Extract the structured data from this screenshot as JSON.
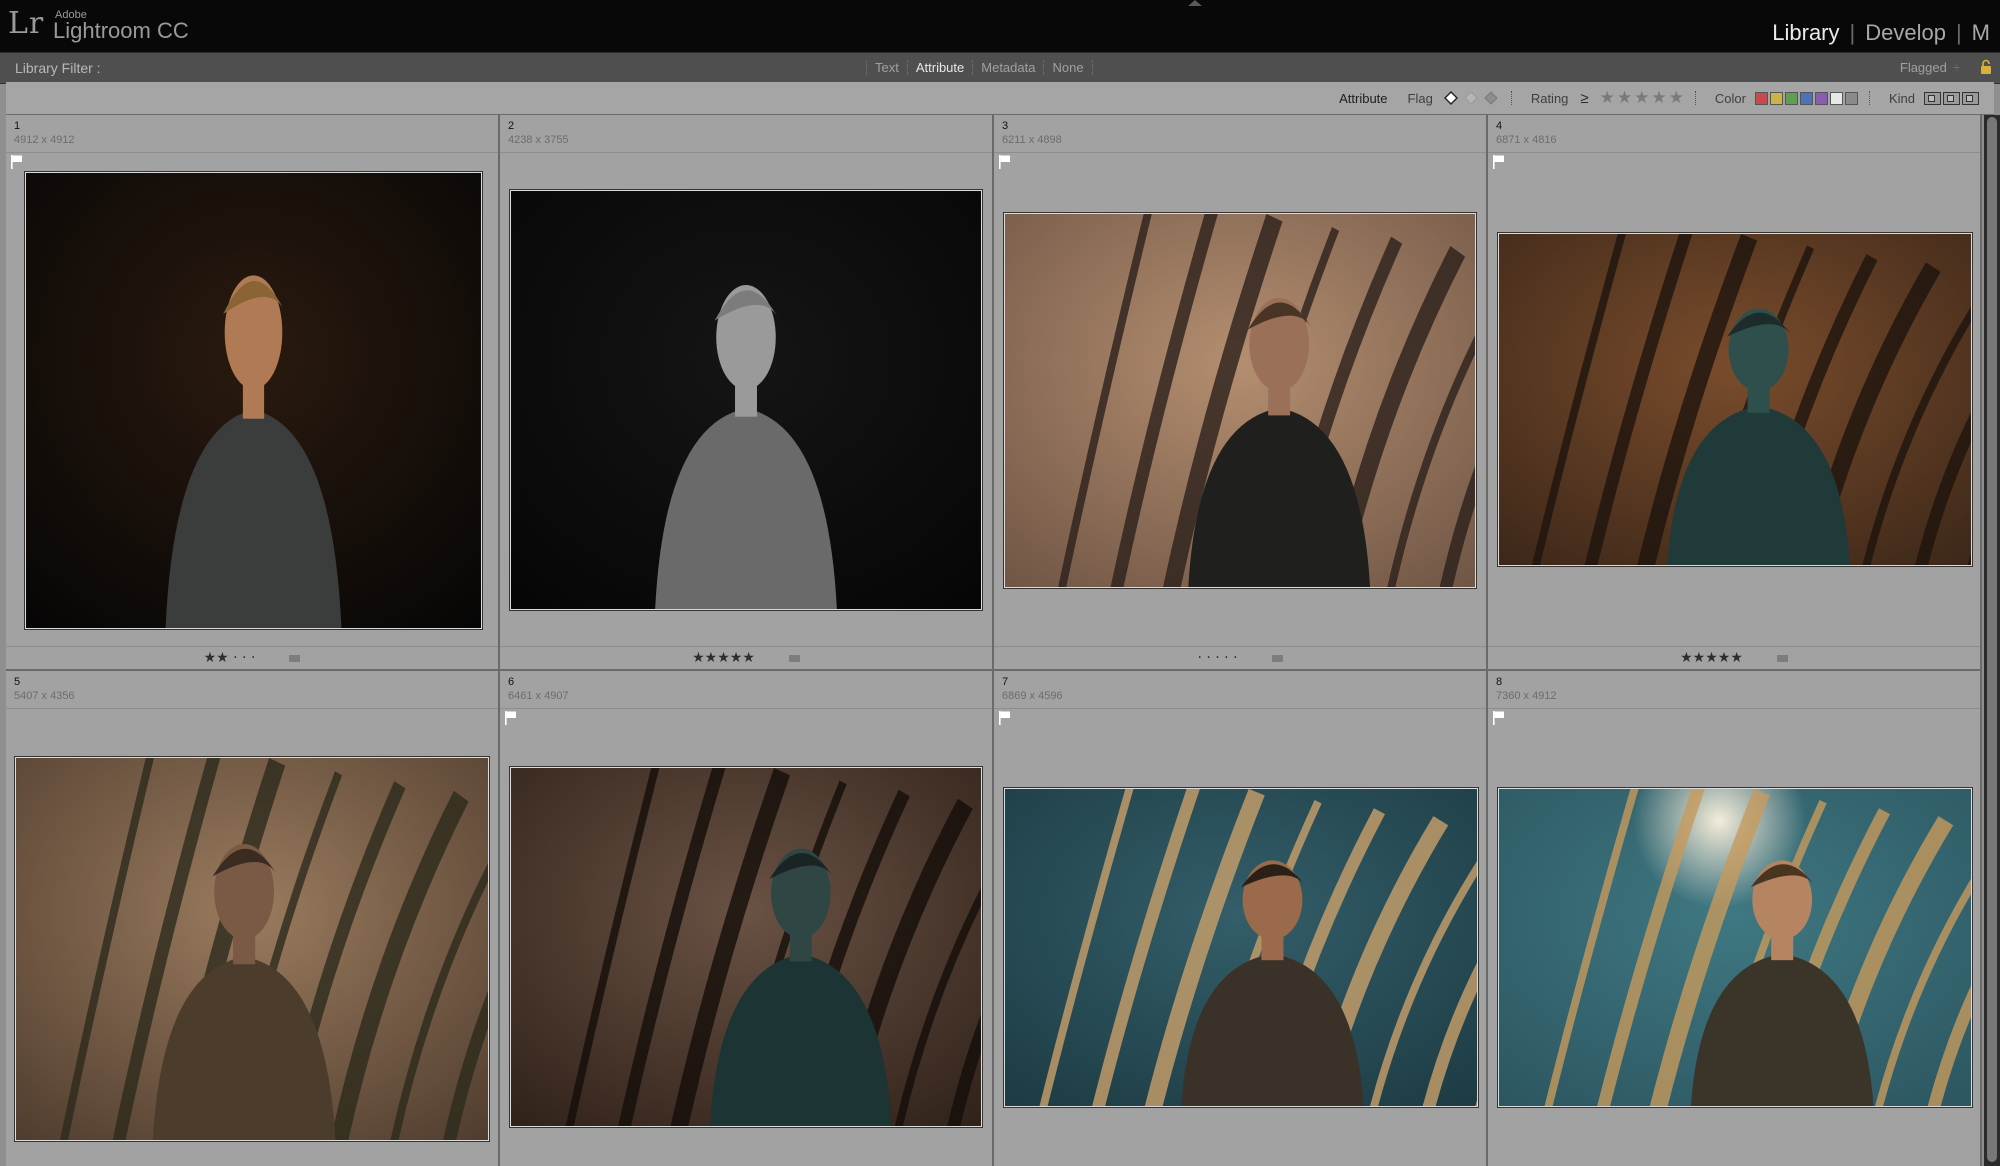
{
  "app": {
    "logo": "Lr",
    "vendor": "Adobe",
    "product": "Lightroom CC"
  },
  "modules": [
    {
      "label": "Library",
      "active": true
    },
    {
      "label": "Develop",
      "active": false
    },
    {
      "label": "M",
      "active": false
    }
  ],
  "library_filter": {
    "label": "Library Filter :",
    "modes": [
      {
        "label": "Text",
        "active": false
      },
      {
        "label": "Attribute",
        "active": true
      },
      {
        "label": "Metadata",
        "active": false
      },
      {
        "label": "None",
        "active": false
      }
    ],
    "preset": "Flagged",
    "preset_caret": "÷"
  },
  "attribute_bar": {
    "title": "Attribute",
    "flag_label": "Flag",
    "rating_label": "Rating",
    "rating_operator": "≥",
    "rating_stars": 5,
    "color_label": "Color",
    "colors": [
      "#c84a4a",
      "#c9b44a",
      "#5f9f4f",
      "#4f72b7",
      "#8a5bb0",
      "#e8e8e8",
      "#8a8a8a"
    ],
    "kind_label": "Kind"
  },
  "grid": {
    "photos": [
      {
        "index": "1",
        "dims": "4912 x 4912",
        "flagged": true,
        "rating": "★★ · · ·",
        "palette": "warm-dark"
      },
      {
        "index": "2",
        "dims": "4238 x 3755",
        "flagged": false,
        "rating": "★★★★★",
        "palette": "mono"
      },
      {
        "index": "3",
        "dims": "6211 x 4898",
        "flagged": true,
        "rating": "· · · · ·",
        "palette": "tan"
      },
      {
        "index": "4",
        "dims": "6871 x 4816",
        "flagged": true,
        "rating": "★★★★★",
        "palette": "amber-teal"
      },
      {
        "index": "5",
        "dims": "5407 x 4356",
        "flagged": false,
        "rating": "",
        "palette": "olive"
      },
      {
        "index": "6",
        "dims": "6461 x 4907",
        "flagged": true,
        "rating": "",
        "palette": "brown-teal"
      },
      {
        "index": "7",
        "dims": "6869 x 4596",
        "flagged": true,
        "rating": "",
        "palette": "teal-gold"
      },
      {
        "index": "8",
        "dims": "7360 x 4912",
        "flagged": true,
        "rating": "",
        "palette": "teal-sun"
      }
    ]
  }
}
